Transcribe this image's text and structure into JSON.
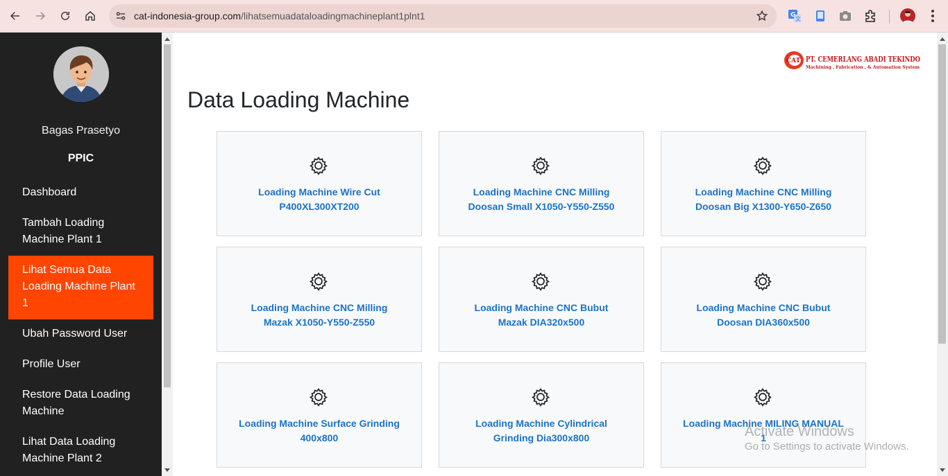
{
  "browser": {
    "url_host": "cat-indonesia-group.com",
    "url_path": "/lihatsemuadataloadingmachineplant1plnt1"
  },
  "sidebar": {
    "user_name": "Bagas Prasetyo",
    "user_role": "PPIC",
    "items": [
      {
        "label": "Dashboard"
      },
      {
        "label": "Tambah Loading Machine Plant 1"
      },
      {
        "label": "Lihat Semua Data Loading Machine Plant 1"
      },
      {
        "label": "Ubah Password User"
      },
      {
        "label": "Profile User"
      },
      {
        "label": "Restore Data Loading Machine"
      },
      {
        "label": "Lihat Data Loading Machine Plant 2"
      }
    ]
  },
  "logo": {
    "mark": "CAT",
    "company": "PT. CEMERLANG ABADI TEKINDO",
    "tagline": "Machining , Fabrication , & Automation System"
  },
  "main": {
    "title": "Data Loading Machine",
    "cards": [
      {
        "line1": "Loading Machine Wire Cut",
        "line2": "P400XL300XT200"
      },
      {
        "line1": "Loading Machine CNC Milling",
        "line2": "Doosan Small X1050-Y550-Z550"
      },
      {
        "line1": "Loading Machine CNC Milling",
        "line2": "Doosan Big X1300-Y650-Z650"
      },
      {
        "line1": "Loading Machine CNC Milling",
        "line2": "Mazak X1050-Y550-Z550"
      },
      {
        "line1": "Loading Machine CNC Bubut",
        "line2": "Mazak DIA320x500"
      },
      {
        "line1": "Loading Machine CNC Bubut",
        "line2": "Doosan DIA360x500"
      },
      {
        "line1": "Loading Machine Surface Grinding",
        "line2": "400x800"
      },
      {
        "line1": "Loading Machine Cylindrical",
        "line2": "Grinding Dia300x800"
      },
      {
        "line1": "Loading Machine MILING MANUAL",
        "line2": "1"
      }
    ]
  },
  "watermark": {
    "title": "Activate Windows",
    "subtitle": "Go to Settings to activate Windows."
  },
  "colors": {
    "sidebar_bg": "#212121",
    "active_item": "#ff4500",
    "card_link": "#1a73c8",
    "card_bg": "#f8f9fa"
  }
}
